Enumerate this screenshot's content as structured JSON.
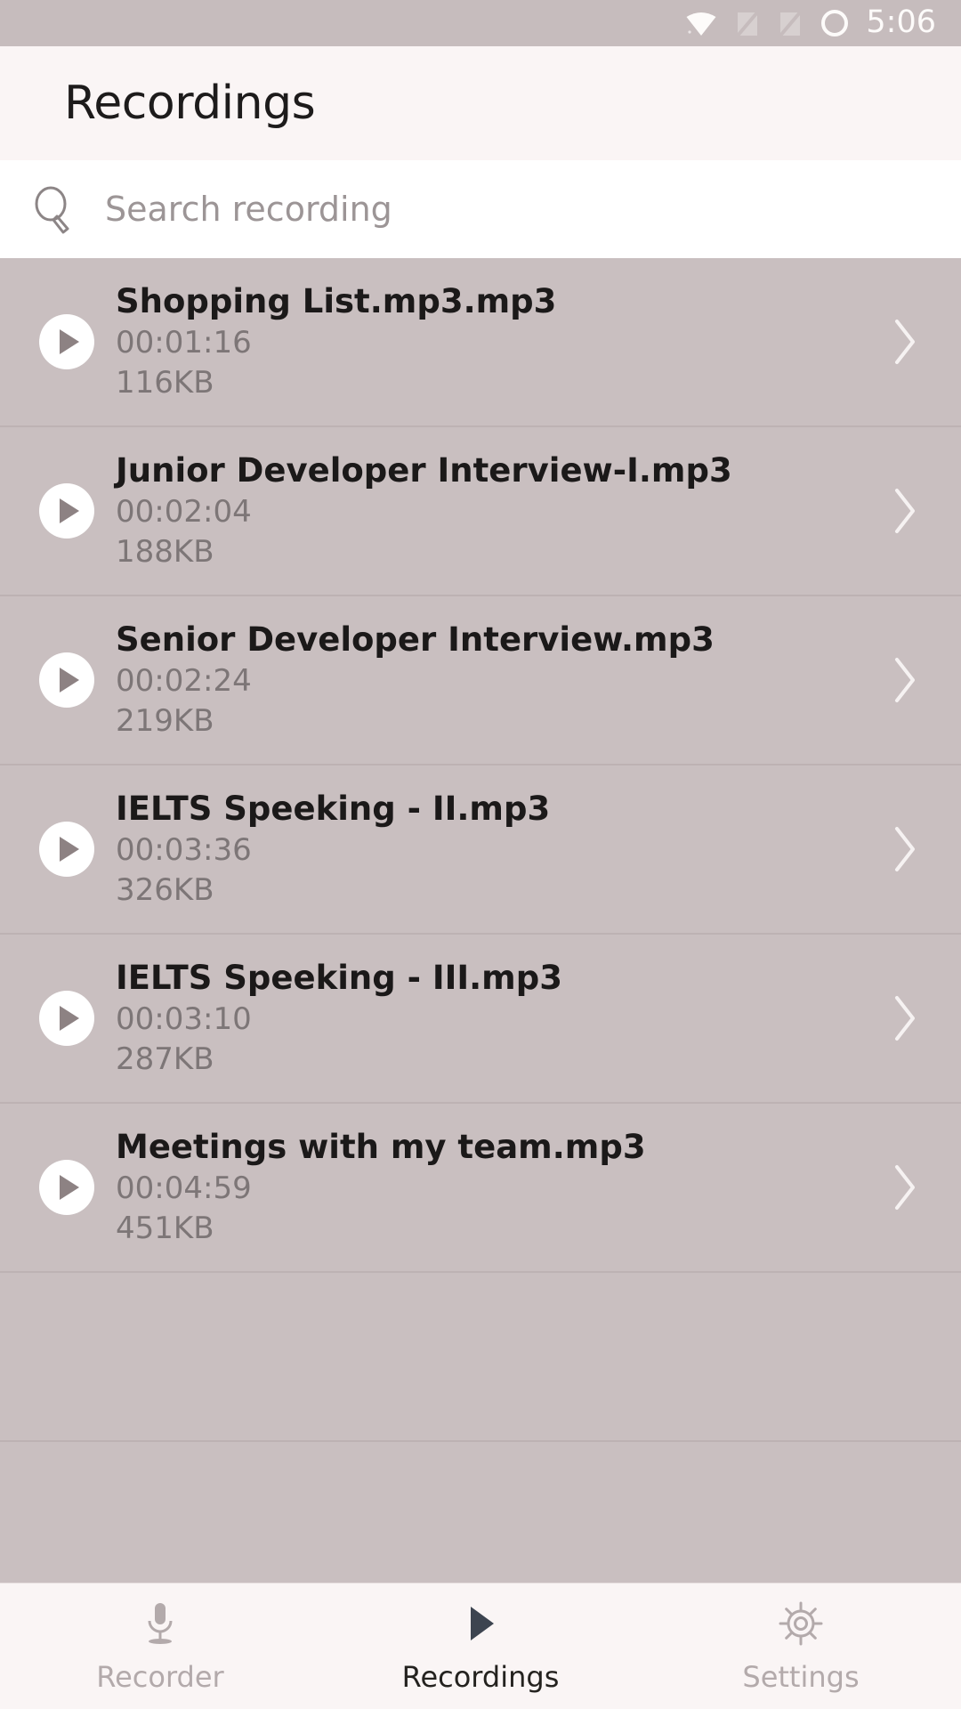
{
  "status_bar": {
    "time": "5:06",
    "icons": [
      "wifi-icon",
      "signal-off-icon",
      "signal-off-icon",
      "battery-circle-icon"
    ]
  },
  "header": {
    "title": "Recordings"
  },
  "search": {
    "icon": "search-icon",
    "placeholder": "Search recording",
    "value": ""
  },
  "recordings": [
    {
      "title": "Shopping List.mp3.mp3",
      "duration": "00:01:16",
      "size": "116KB"
    },
    {
      "title": "Junior Developer Interview-I.mp3",
      "duration": "00:02:04",
      "size": "188KB"
    },
    {
      "title": "Senior Developer Interview.mp3",
      "duration": "00:02:24",
      "size": "219KB"
    },
    {
      "title": "IELTS Speeking - II.mp3",
      "duration": "00:03:36",
      "size": "326KB"
    },
    {
      "title": "IELTS Speeking - III.mp3",
      "duration": "00:03:10",
      "size": "287KB"
    },
    {
      "title": "Meetings with my team.mp3",
      "duration": "00:04:59",
      "size": "451KB"
    }
  ],
  "bottom_nav": {
    "tabs": [
      {
        "label": "Recorder",
        "icon": "microphone-icon",
        "active": false
      },
      {
        "label": "Recordings",
        "icon": "play-icon",
        "active": true
      },
      {
        "label": "Settings",
        "icon": "gear-icon",
        "active": false
      }
    ]
  },
  "colors": {
    "list_background": "#c9bfc0",
    "header_background": "#faf5f5",
    "search_background": "#ffffff",
    "status_bar_background": "#c6bcbd",
    "title_text": "#1b1919",
    "secondary_text": "#7d7677",
    "active_tab": "#3d4450",
    "inactive_tab": "#b3aaab"
  }
}
